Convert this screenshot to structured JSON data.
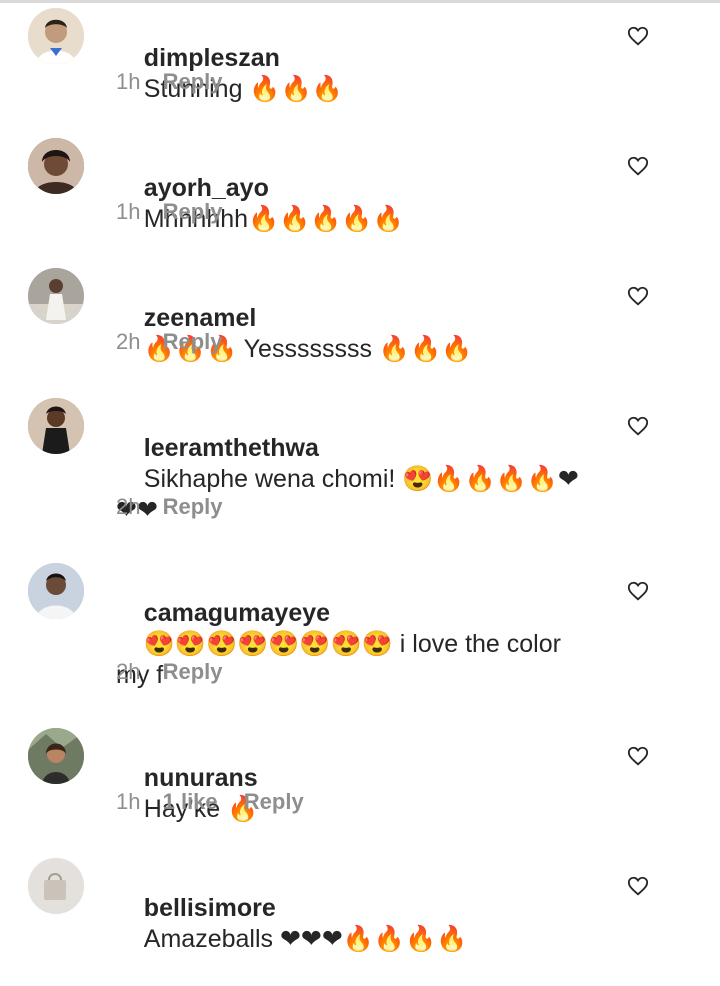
{
  "comments": [
    {
      "username": "dimpleszan",
      "text": "Stunning 🔥🔥🔥",
      "time": "1h",
      "likes": "",
      "reply": "Reply",
      "avatar_icon": "user-avatar",
      "avatar_bg": "#d8c7b4"
    },
    {
      "username": "ayorh_ayo",
      "text": "Mhhhhhh🔥🔥🔥🔥🔥",
      "time": "1h",
      "likes": "",
      "reply": "Reply",
      "avatar_icon": "user-avatar",
      "avatar_bg": "#8a6a55"
    },
    {
      "username": "zeenamel",
      "text": "🔥🔥🔥 Yessssssss 🔥🔥🔥",
      "time": "2h",
      "likes": "",
      "reply": "Reply",
      "avatar_icon": "user-avatar",
      "avatar_bg": "#b9b2a8"
    },
    {
      "username": "leeramthethwa",
      "text": "Sikhaphe wena chomi! 😍🔥🔥🔥🔥❤❤❤",
      "time": "2h",
      "likes": "",
      "reply": "Reply",
      "avatar_icon": "user-avatar",
      "avatar_bg": "#a08870"
    },
    {
      "username": "camagumayeye",
      "text": "😍😍😍😍😍😍😍😍 i love the color my f",
      "time": "2h",
      "likes": "",
      "reply": "Reply",
      "avatar_icon": "user-avatar",
      "avatar_bg": "#9fb0c8"
    },
    {
      "username": "nunurans",
      "text": "Hay’ke 🔥",
      "time": "1h",
      "likes": "1 like",
      "reply": "Reply",
      "avatar_icon": "user-avatar",
      "avatar_bg": "#7d8a72"
    },
    {
      "username": "bellisimore",
      "text": "Amazeballs ❤❤❤🔥🔥🔥🔥",
      "time": "",
      "likes": "",
      "reply": "",
      "avatar_icon": "user-avatar",
      "avatar_bg": "#d9d6d2"
    }
  ],
  "icons": {
    "like": "heart-outline-icon"
  },
  "colors": {
    "text": "#262626",
    "meta": "#8e8e8e",
    "divider": "#d9d9d9"
  }
}
